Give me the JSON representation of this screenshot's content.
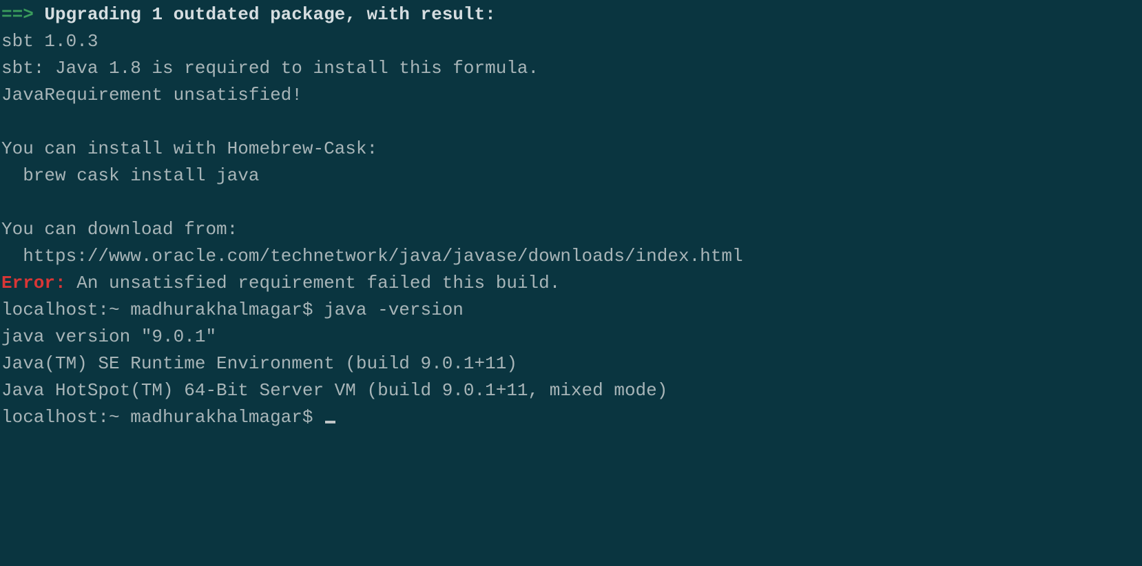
{
  "arrow": "==>",
  "upgrade_header": " Upgrading 1 outdated package, with result:",
  "line_sbt_version": "sbt 1.0.3",
  "line_sbt_java": "sbt: Java 1.8 is required to install this formula.",
  "line_unsat": "JavaRequirement unsatisfied!",
  "blank": "",
  "line_cask1": "You can install with Homebrew-Cask:",
  "line_cask2": "  brew cask install java",
  "line_dl1": "You can download from:",
  "line_dl2": "  https://www.oracle.com/technetwork/java/javase/downloads/index.html",
  "error_label": "Error:",
  "error_msg": " An unsatisfied requirement failed this build.",
  "prompt1": "localhost:~ madhurakhalmagar$ ",
  "cmd1": "java -version",
  "line_jver": "java version \"9.0.1\"",
  "line_jre": "Java(TM) SE Runtime Environment (build 9.0.1+11)",
  "line_jvm": "Java HotSpot(TM) 64-Bit Server VM (build 9.0.1+11, mixed mode)",
  "prompt2": "localhost:~ madhurakhalmagar$ "
}
